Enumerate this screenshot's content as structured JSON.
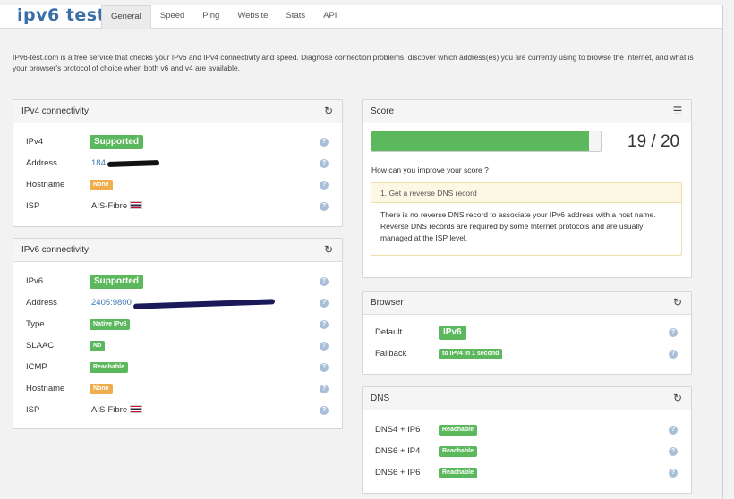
{
  "logo": "ipv6 test",
  "tabs": [
    {
      "label": "General",
      "active": true
    },
    {
      "label": "Speed"
    },
    {
      "label": "Ping"
    },
    {
      "label": "Website"
    },
    {
      "label": "Stats"
    },
    {
      "label": "API"
    }
  ],
  "intro": "IPv6-test.com is a free service that checks your IPv6 and IPv4 connectivity and speed. Diagnose connection problems, discover which address(es) you are currently using to browse the Internet, and what is your browser's protocol of choice when both v6 and v4 are available.",
  "ipv4": {
    "title": "IPv4 connectivity",
    "rows": [
      {
        "label": "IPv4",
        "value": "Supported"
      },
      {
        "label": "Address",
        "value": "184."
      },
      {
        "label": "Hostname",
        "value": "None"
      },
      {
        "label": "ISP",
        "value": "AIS-Fibre"
      }
    ]
  },
  "ipv6": {
    "title": "IPv6 connectivity",
    "rows": [
      {
        "label": "IPv6",
        "value": "Supported"
      },
      {
        "label": "Address",
        "value": "2405:9800"
      },
      {
        "label": "Type",
        "value": "Native IPv6"
      },
      {
        "label": "SLAAC",
        "value": "No"
      },
      {
        "label": "ICMP",
        "value": "Reachable"
      },
      {
        "label": "Hostname",
        "value": "None"
      },
      {
        "label": "ISP",
        "value": "AIS-Fibre"
      }
    ]
  },
  "score": {
    "title": "Score",
    "value": "19 / 20",
    "fraction": 0.95,
    "improve": "How can you improve your score ?",
    "tip_title": "1. Get a reverse DNS record",
    "tip_body": "There is no reverse DNS record to associate your IPv6 address with a host name. Reverse DNS records are required by some Internet protocols and are usually managed at the ISP level."
  },
  "browser": {
    "title": "Browser",
    "rows": [
      {
        "label": "Default",
        "value": "IPv6"
      },
      {
        "label": "Fallback",
        "value": "to IPv4 in 1 second"
      }
    ]
  },
  "dns": {
    "title": "DNS",
    "rows": [
      {
        "label": "DNS4 + IP6",
        "value": "Reachable"
      },
      {
        "label": "DNS6 + IP4",
        "value": "Reachable"
      },
      {
        "label": "DNS6 + IP6",
        "value": "Reachable"
      }
    ]
  },
  "colors": {
    "success": "#5cb85c",
    "warning": "#f0ad4e",
    "link": "#3a77b5",
    "accent": "#3a6ea8"
  },
  "icons": {
    "refresh": "refresh-icon",
    "list": "list-icon",
    "help": "help-icon"
  }
}
